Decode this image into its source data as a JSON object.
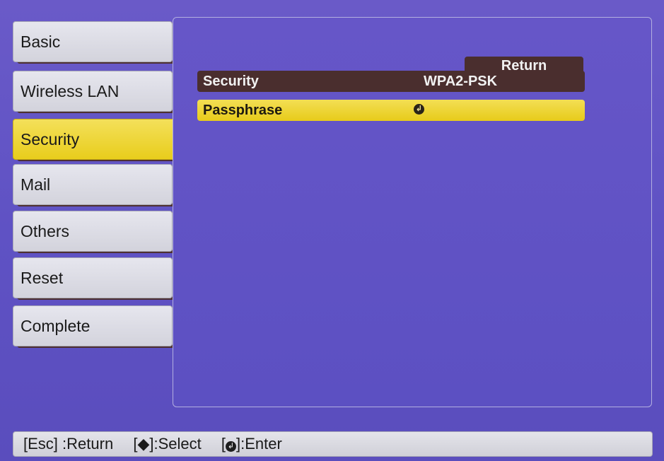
{
  "sidebar": {
    "items": [
      {
        "label": "Basic"
      },
      {
        "label": "Wireless LAN"
      },
      {
        "label": "Security"
      },
      {
        "label": "Mail"
      },
      {
        "label": "Others"
      },
      {
        "label": "Reset"
      },
      {
        "label": "Complete"
      }
    ],
    "active": "Security"
  },
  "panel": {
    "return_label": "Return",
    "rows": [
      {
        "label": "Security",
        "value": "WPA2-PSK"
      },
      {
        "label": "Passphrase",
        "value": "",
        "icon": "enter-icon"
      }
    ]
  },
  "help_bar": {
    "esc": {
      "key": "[Esc]",
      "action": ":Return"
    },
    "select": {
      "key_open": "[",
      "glyph": "◆",
      "key_close": "]",
      "action": ":Select"
    },
    "enter": {
      "key_open": "[",
      "glyph": "↲",
      "key_close": "]",
      "action": ":Enter"
    }
  },
  "colors": {
    "background": "#6056c4",
    "highlight": "#ecd22a",
    "row_dark": "#4a2e2e",
    "tab": "#dcdce4"
  }
}
